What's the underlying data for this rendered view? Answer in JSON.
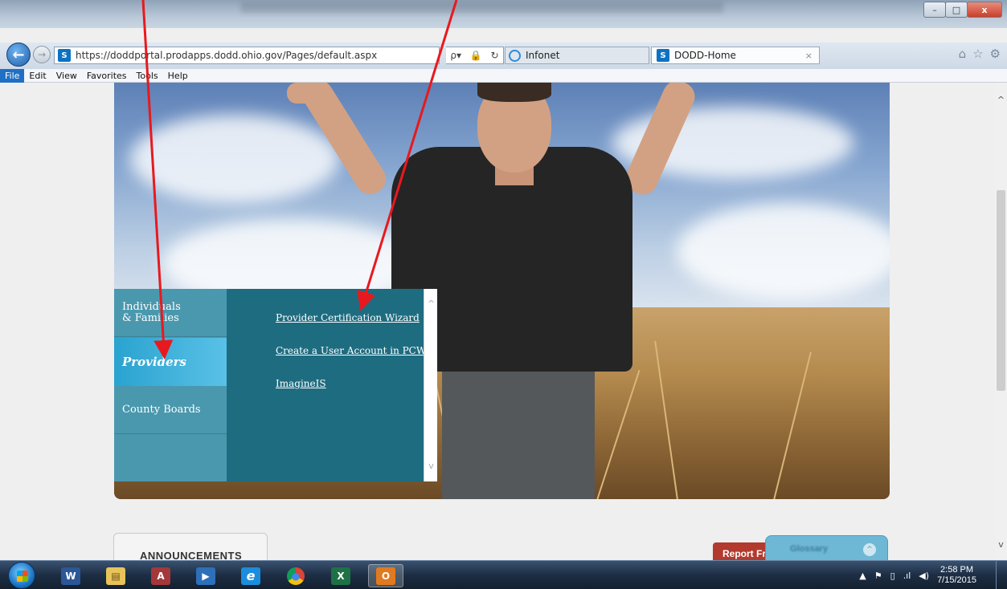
{
  "browser": {
    "window_buttons": {
      "minimize": "–",
      "maximize": "□",
      "close": "x"
    },
    "nav": {
      "back_icon": "←",
      "forward_icon": "→"
    },
    "address_url": "https://doddportal.prodapps.dodd.ohio.gov/Pages/default.aspx",
    "address_tools": {
      "search": "ρ▾",
      "lock": "🔒",
      "refresh": "↻"
    },
    "tabs": [
      {
        "label": "Infonet"
      },
      {
        "label": "DODD-Home",
        "close": "×"
      }
    ],
    "right_tools": {
      "home": "⌂",
      "favorites": "☆",
      "settings": "⚙"
    },
    "menu": [
      "File",
      "Edit",
      "View",
      "Favorites",
      "Tools",
      "Help"
    ]
  },
  "scroll": {
    "up": "^",
    "down": "v"
  },
  "audience_menu": {
    "items": [
      {
        "label": "Individuals & Families",
        "line1": "Individuals",
        "line2": "& Families"
      },
      {
        "label": "Providers"
      },
      {
        "label": "County Boards"
      }
    ],
    "sub_links": [
      {
        "label": "Provider Certification Wizard"
      },
      {
        "label": "Create a User Account in PCW"
      },
      {
        "label": "ImagineIS"
      }
    ],
    "scroll_up": "^",
    "scroll_down": "v"
  },
  "announcements": {
    "title": "ANNOUNCEMENTS"
  },
  "report_button": {
    "label": "Report Fr"
  },
  "glossary": {
    "label": "Glossary",
    "toggle": "^"
  },
  "taskbar": {
    "apps": [
      {
        "glyph": "W"
      },
      {
        "glyph": "▤"
      },
      {
        "glyph": "A"
      },
      {
        "glyph": "▶"
      },
      {
        "glyph": "e"
      },
      {
        "glyph": "●"
      },
      {
        "glyph": "X"
      },
      {
        "glyph": "O"
      }
    ],
    "tray": {
      "show_icons": "▲",
      "flag": "⚑",
      "battery": "▯",
      "signal": ".ıl",
      "volume": "◀)"
    },
    "time": "2:58 PM",
    "date": "7/15/2015"
  },
  "colors": {
    "menu_left": "#4a98ae",
    "menu_right": "#1e6c80",
    "providers_active": "#2aa3d0",
    "annotation_arrow": "#e8191e",
    "report_button": "#b23a2e",
    "glossary_panel": "#6eb8d6"
  }
}
